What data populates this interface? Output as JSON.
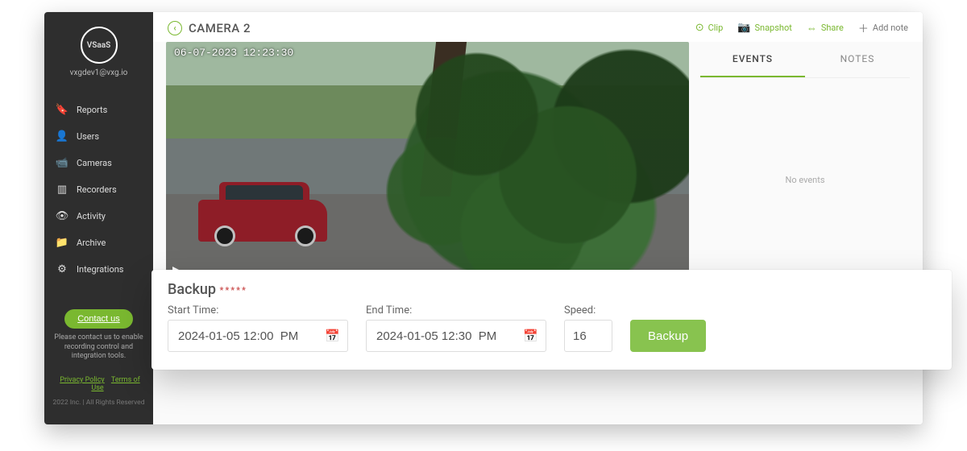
{
  "brand": {
    "logo_text": "VSaaS",
    "user_email": "vxgdev1@vxg.io"
  },
  "sidebar": {
    "items": [
      {
        "icon": "bookmark-icon",
        "glyph": "🔖",
        "label": "Reports"
      },
      {
        "icon": "user-icon",
        "glyph": "👤",
        "label": "Users"
      },
      {
        "icon": "camera-icon",
        "glyph": "📹",
        "label": "Cameras"
      },
      {
        "icon": "recorder-icon",
        "glyph": "▥",
        "label": "Recorders"
      },
      {
        "icon": "eye-icon",
        "glyph": "👁",
        "label": "Activity"
      },
      {
        "icon": "folder-icon",
        "glyph": "📁",
        "label": "Archive"
      },
      {
        "icon": "gear-icon",
        "glyph": "⚙",
        "label": "Integrations"
      }
    ],
    "contact_label": "Contact us",
    "contact_note": "Please contact us to enable recording control and integration tools.",
    "legal": {
      "privacy": "Privacy Policy",
      "terms": "Terms of Use"
    },
    "copyright": "2022 Inc. | All Rights Reserved"
  },
  "header": {
    "camera_title": "CAMERA 2",
    "actions": {
      "clip": "Clip",
      "snapshot": "Snapshot",
      "share": "Share",
      "add_note": "Add note"
    }
  },
  "video": {
    "timestamp": "06-07-2023 12:23:30"
  },
  "tabs": {
    "events": "EVENTS",
    "notes": "NOTES"
  },
  "events_panel": {
    "empty_text": "No events"
  },
  "backup_large": {
    "title": "Backup",
    "required_marker": "*****",
    "start_label": "Start Time:",
    "start_value": "2024-01-05 12:00  PM",
    "end_label": "End Time:",
    "end_value": "2024-01-05 12:30  PM",
    "speed_label": "Speed:",
    "speed_value": "16",
    "button": "Backup"
  },
  "backup_small": {
    "title": "Backup",
    "required_marker": "*****",
    "start_label": "Start Time:",
    "start_value": "2024-01-05 12:00  PM",
    "end_label": "End Time:",
    "end_value": "2024-01-05 12:30  PM",
    "speed_label": "Speed:",
    "speed_value": "16",
    "button": "Backup"
  }
}
